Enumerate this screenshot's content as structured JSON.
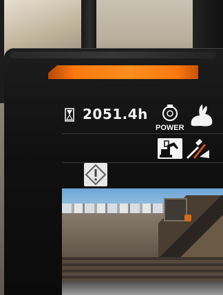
{
  "display": {
    "hour_meter": "2051.4h",
    "power_mode_label": "POWER",
    "status_bar_color": "#ff7a10",
    "icons": {
      "hour_meter": "hourglass-icon",
      "power_mode": "power-mode-icon",
      "speed": "rabbit-icon",
      "work_mode": "excavator-work-mode-icon",
      "attachment": "attachment-tools-icon",
      "warning": "warning-diamond-icon"
    }
  }
}
